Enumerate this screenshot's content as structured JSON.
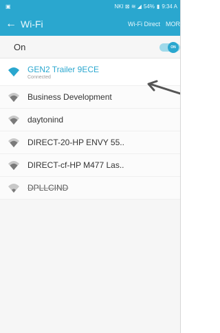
{
  "status_bar": {
    "icons": "NKI ⊠ ≋ ◢",
    "battery": "54%",
    "time": "9:34 A"
  },
  "app_bar": {
    "back_icon": "←",
    "title": "Wi-Fi",
    "wifi_direct": "Wi-Fi Direct",
    "more": "MOR"
  },
  "toggle_row": {
    "label": "On",
    "switch_text": "ON",
    "state": true
  },
  "colors": {
    "accent": "#2aa7cf",
    "toggle_track": "#9fd9ea"
  },
  "networks": [
    {
      "name": "GEN2 Trailer 9ECE",
      "status": "Connected",
      "connected": true,
      "signal": 4
    },
    {
      "name": "Business Development",
      "status": "",
      "connected": false,
      "signal": 3
    },
    {
      "name": "daytonind",
      "status": "",
      "connected": false,
      "signal": 3
    },
    {
      "name": "DIRECT-20-HP ENVY 55..",
      "status": "",
      "connected": false,
      "signal": 3
    },
    {
      "name": "DIRECT-cf-HP M477 Las..",
      "status": "",
      "connected": false,
      "signal": 3
    },
    {
      "name": "DPLLCIND",
      "status": "",
      "connected": false,
      "signal": 2
    }
  ]
}
